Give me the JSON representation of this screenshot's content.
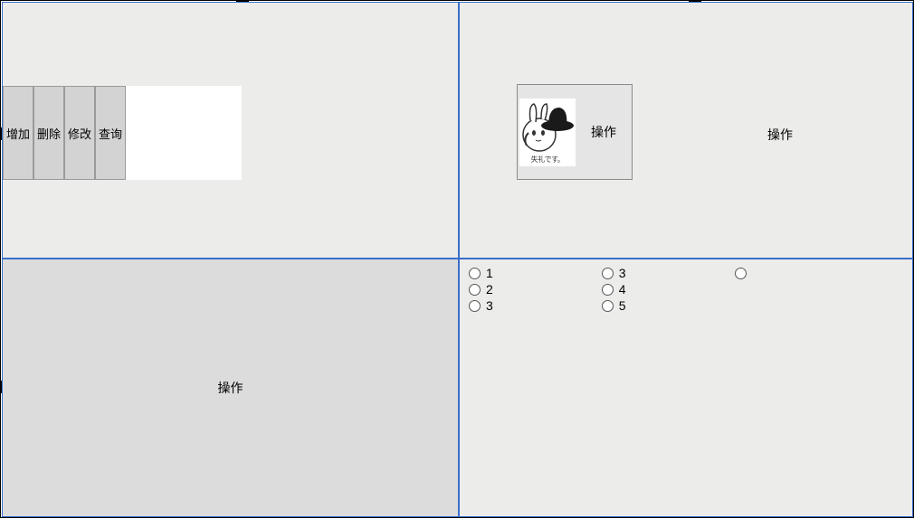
{
  "quadrants": {
    "top_left": {
      "buttons": [
        "增加",
        "删除",
        "修改",
        "查询"
      ]
    },
    "top_right": {
      "box_label": "操作",
      "image_caption": "失礼です。",
      "outer_label": "操作"
    },
    "bottom_left": {
      "label": "操作"
    },
    "bottom_right": {
      "radio_groups": [
        {
          "items": [
            "1",
            "2",
            "3"
          ]
        },
        {
          "items": [
            "3",
            "4",
            "5"
          ]
        },
        {
          "items": [
            ""
          ]
        }
      ]
    }
  }
}
